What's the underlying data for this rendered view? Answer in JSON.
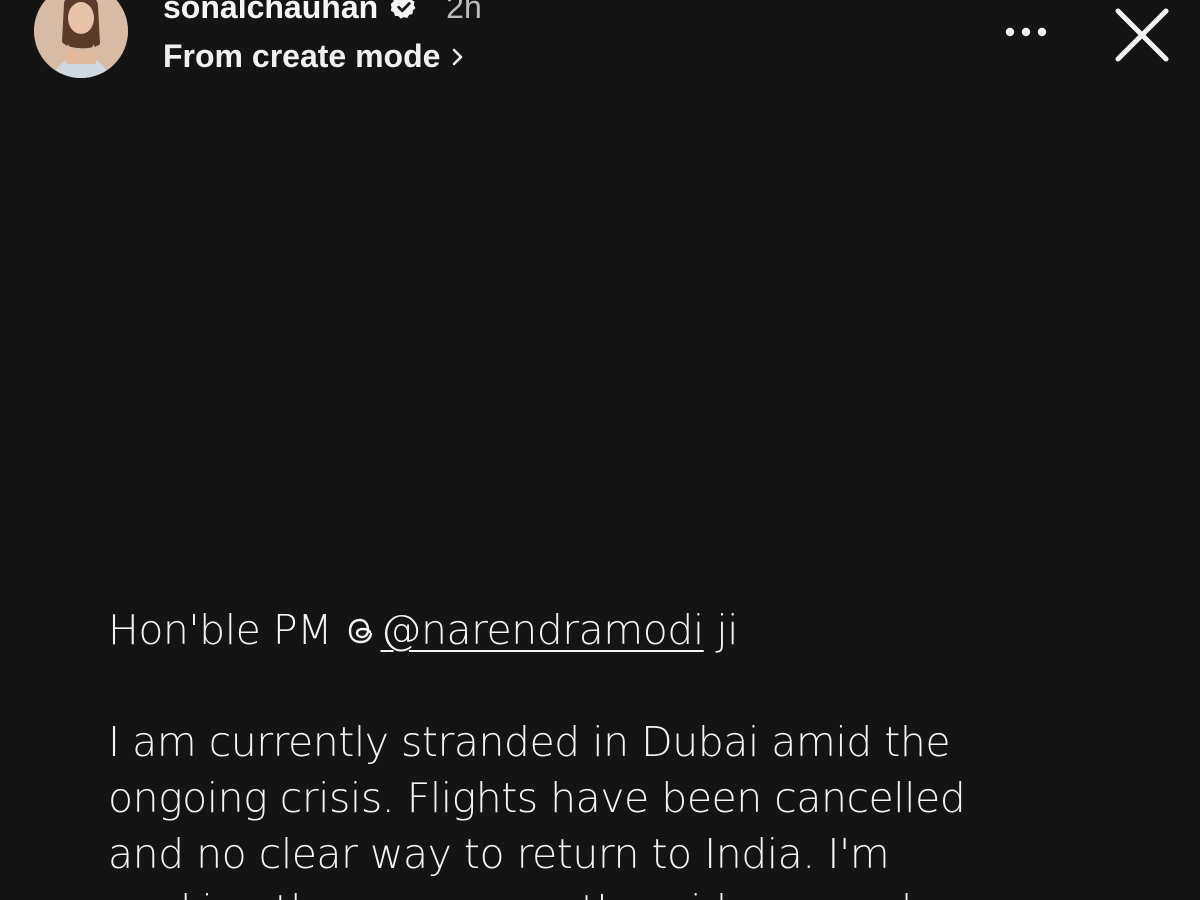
{
  "header": {
    "username": "sonalchauhan",
    "timestamp": "2h",
    "subtitle": "From create mode",
    "icons": {
      "avatar": "profile-photo",
      "verified": "verified-badge-icon",
      "subtitle_chevron": "chevron-right-icon",
      "more": "more-options-icon",
      "close": "close-icon"
    }
  },
  "post": {
    "salutation_prefix": "Hon'ble PM ",
    "mention": "@narendramodi",
    "mention_icon": "threads-icon",
    "salutation_suffix": " ji",
    "lines": [
      "I am currently stranded in Dubai amid the",
      "ongoing crisis. Flights have been cancelled",
      "and no clear way  to return to India. I'm",
      "seeking the government's guidance and"
    ]
  },
  "colors": {
    "background": "#141414",
    "text": "#f4f4f4",
    "muted": "#bdbdbd"
  }
}
